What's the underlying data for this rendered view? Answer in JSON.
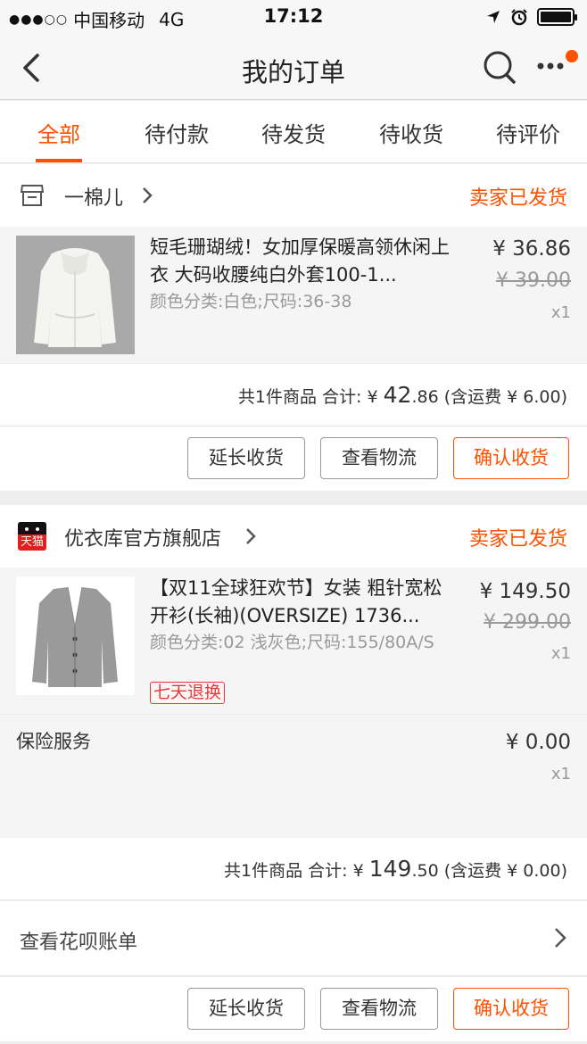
{
  "status_bar": {
    "carrier": "中国移动",
    "network": "4G",
    "time": "17:12"
  },
  "header": {
    "title": "我的订单"
  },
  "tabs": [
    {
      "label": "全部",
      "active": true
    },
    {
      "label": "待付款"
    },
    {
      "label": "待发货"
    },
    {
      "label": "待收货"
    },
    {
      "label": "待评价"
    }
  ],
  "orders": [
    {
      "store": "一棉儿",
      "status": "卖家已发货",
      "item": {
        "title": "短毛珊瑚绒！女加厚保暖高领休闲上衣 大码收腰纯白外套100-1...",
        "sku": "颜色分类:白色;尺码:36-38",
        "price": "¥ 36.86",
        "original_price": "¥ 39.00",
        "qty": "x1"
      },
      "summary": {
        "prefix": "共1件商品 合计: ¥ ",
        "integer": "42",
        "decimal": ".86",
        "shipping": " (含运费 ¥ 6.00)"
      },
      "actions": [
        "延长收货",
        "查看物流",
        "确认收货"
      ]
    },
    {
      "store": "优衣库官方旗舰店",
      "store_badge": "天猫",
      "status": "卖家已发货",
      "item": {
        "title": "【双11全球狂欢节】女装 粗针宽松开衫(长袖)(OVERSIZE) 1736...",
        "sku": "颜色分类:02 浅灰色;尺码:155/80A/S",
        "tag": "七天退换",
        "price": "¥ 149.50",
        "original_price": "¥ 299.00",
        "qty": "x1"
      },
      "insurance": {
        "label": "保险服务",
        "price": "¥ 0.00",
        "qty": "x1"
      },
      "summary": {
        "prefix": "共1件商品 合计: ¥ ",
        "integer": "149",
        "decimal": ".50",
        "shipping": " (含运费 ¥ 0.00)"
      },
      "huabei": "查看花呗账单",
      "actions": [
        "延长收货",
        "查看物流",
        "确认收货"
      ]
    }
  ],
  "colors": {
    "accent": "#ff5000",
    "tag_red": "#e4393c",
    "tmall_red": "#e21e1e"
  }
}
